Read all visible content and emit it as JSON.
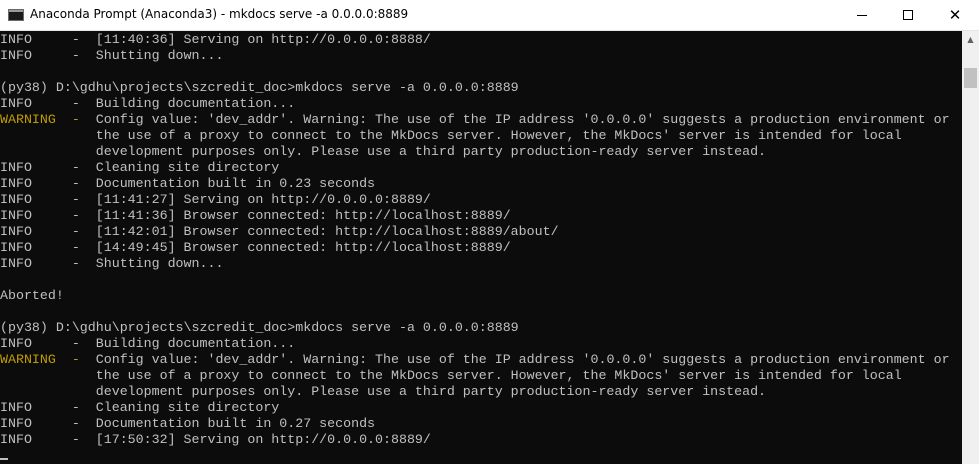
{
  "window": {
    "title": "Anaconda Prompt (Anaconda3) - mkdocs  serve -a 0.0.0.0:8889",
    "minimize_glyph": "—",
    "maximize_glyph": "☐",
    "close_glyph": "✕",
    "icon": "console-icon"
  },
  "colors": {
    "background": "#0c0c0c",
    "text": "#c0c0c0",
    "warning": "#c19c00"
  },
  "console": {
    "lines": [
      "INFO     -  [11:40:36] Serving on http://0.0.0.0:8888/",
      "INFO     -  Shutting down...",
      "",
      "(py38) D:\\gdhu\\projects\\szcredit_doc>mkdocs serve -a 0.0.0.0:8889",
      "INFO     -  Building documentation...",
      "WARNING  -  Config value: 'dev_addr'. Warning: The use of the IP address '0.0.0.0' suggests a production environment or",
      "            the use of a proxy to connect to the MkDocs server. However, the MkDocs' server is intended for local",
      "            development purposes only. Please use a third party production-ready server instead.",
      "INFO     -  Cleaning site directory",
      "INFO     -  Documentation built in 0.23 seconds",
      "INFO     -  [11:41:27] Serving on http://0.0.0.0:8889/",
      "INFO     -  [11:41:36] Browser connected: http://localhost:8889/",
      "INFO     -  [11:42:01] Browser connected: http://localhost:8889/about/",
      "INFO     -  [14:49:45] Browser connected: http://localhost:8889/",
      "INFO     -  Shutting down...",
      "",
      "Aborted!",
      "",
      "(py38) D:\\gdhu\\projects\\szcredit_doc>mkdocs serve -a 0.0.0.0:8889",
      "INFO     -  Building documentation...",
      "WARNING  -  Config value: 'dev_addr'. Warning: The use of the IP address '0.0.0.0' suggests a production environment or",
      "            the use of a proxy to connect to the MkDocs server. However, the MkDocs' server is intended for local",
      "            development purposes only. Please use a third party production-ready server instead.",
      "INFO     -  Cleaning site directory",
      "INFO     -  Documentation built in 0.27 seconds",
      "INFO     -  [17:50:32] Serving on http://0.0.0.0:8889/"
    ]
  },
  "scrollbar": {
    "up_arrow": "▲",
    "position": 0.05
  }
}
